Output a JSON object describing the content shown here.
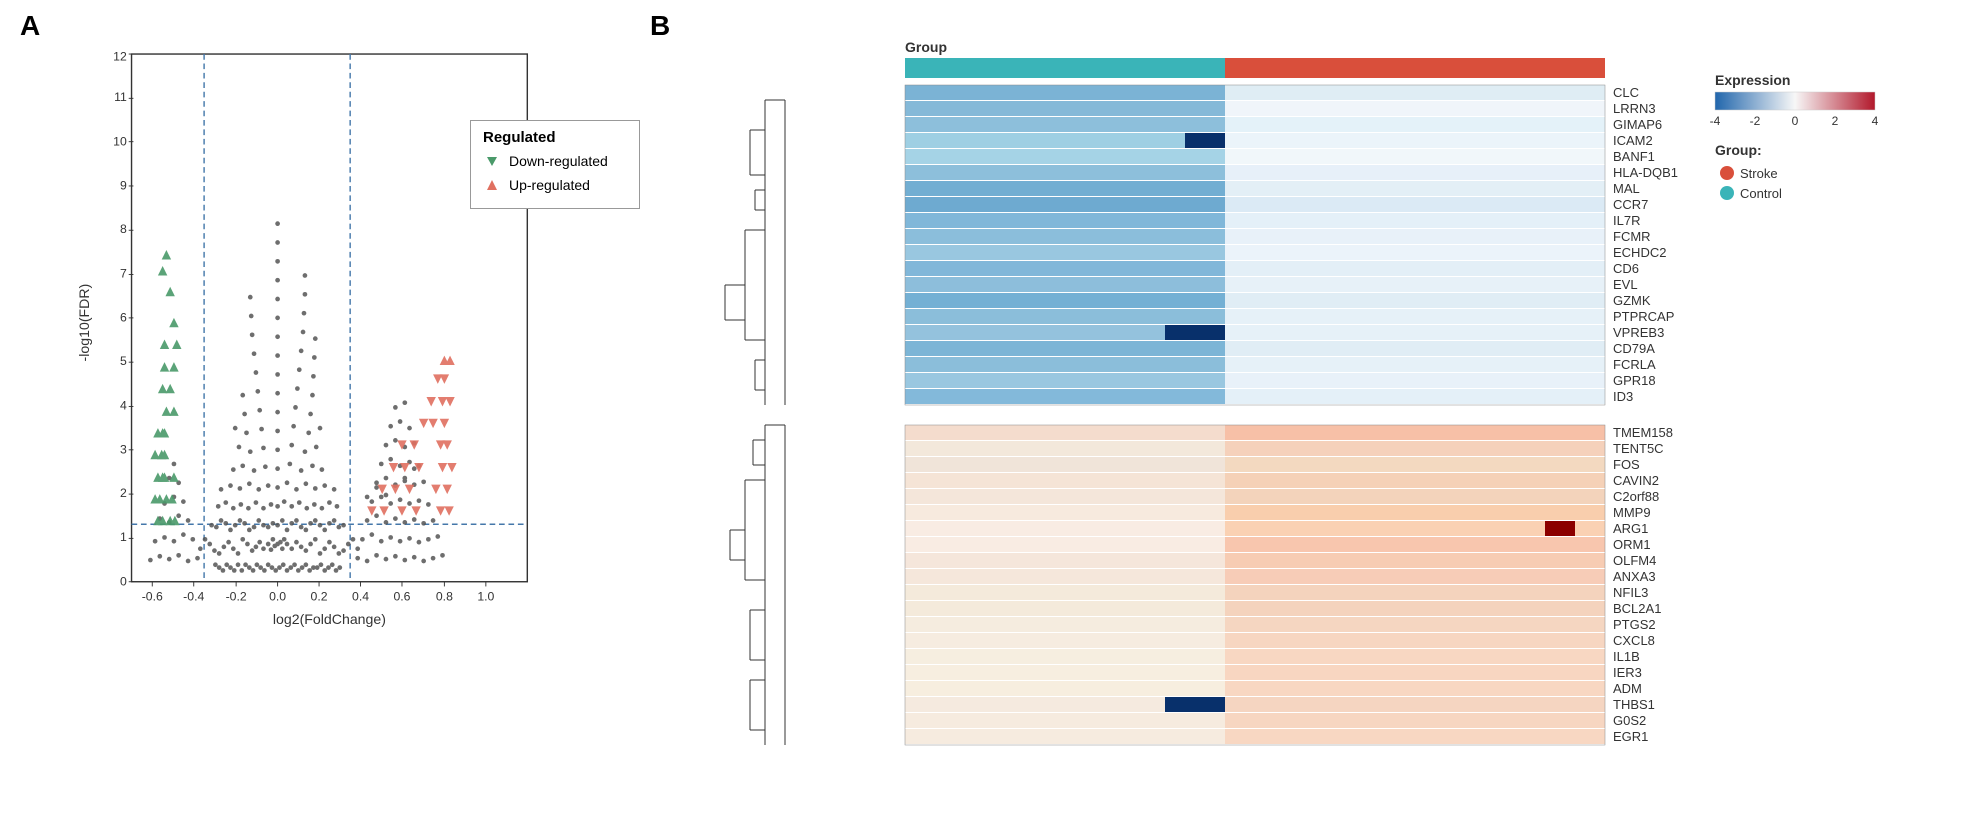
{
  "panelA": {
    "letter": "A",
    "xAxisLabel": "log2(FoldChange)",
    "yAxisLabel": "-log10(FDR)",
    "xTicks": [
      "-0.6",
      "-0.4",
      "-0.2",
      "0.0",
      "0.2",
      "0.4",
      "0.6",
      "0.8",
      "1.0"
    ],
    "yTicks": [
      "0",
      "1",
      "2",
      "3",
      "4",
      "5",
      "6",
      "7",
      "8",
      "9",
      "10",
      "11",
      "12"
    ],
    "legend": {
      "title": "Regulated",
      "downLabel": "Down-regulated",
      "upLabel": "Up-regulated"
    },
    "thresholds": {
      "xLeft": -0.35,
      "xRight": 0.35,
      "yFDR": 1.3
    }
  },
  "panelB": {
    "letter": "B",
    "groupLabel": "Group",
    "genesTop": [
      "CLC",
      "LRRN3",
      "GIMAP6",
      "ICAM2",
      "BANF1",
      "HLA-DQB1",
      "MAL",
      "CCR7",
      "IL7R",
      "FCMR",
      "ECHDC2",
      "CD6",
      "EVL",
      "GZMK",
      "PTPRCAP",
      "VPREB3",
      "CD79A",
      "FCRLA",
      "GPR18",
      "ID3"
    ],
    "genesBottom": [
      "TMEM158",
      "TENT5C",
      "FOS",
      "CAVIN2",
      "C2orf88",
      "MMP9",
      "ARG1",
      "ORM1",
      "OLFM4",
      "ANXA3",
      "NFIL3",
      "BCL2A1",
      "PTGS2",
      "CXCL8",
      "IL1B",
      "IER3",
      "ADM",
      "THBS1",
      "G0S2",
      "EGR1"
    ],
    "legend": {
      "expressionTitle": "Expression",
      "groupTitle": "Group:",
      "strokeLabel": "Stroke",
      "controlLabel": "Control",
      "colorScaleMin": -4,
      "colorScaleMax": 4,
      "colorTicks": [
        "-4",
        "-2",
        "0",
        "2",
        "4"
      ]
    }
  }
}
